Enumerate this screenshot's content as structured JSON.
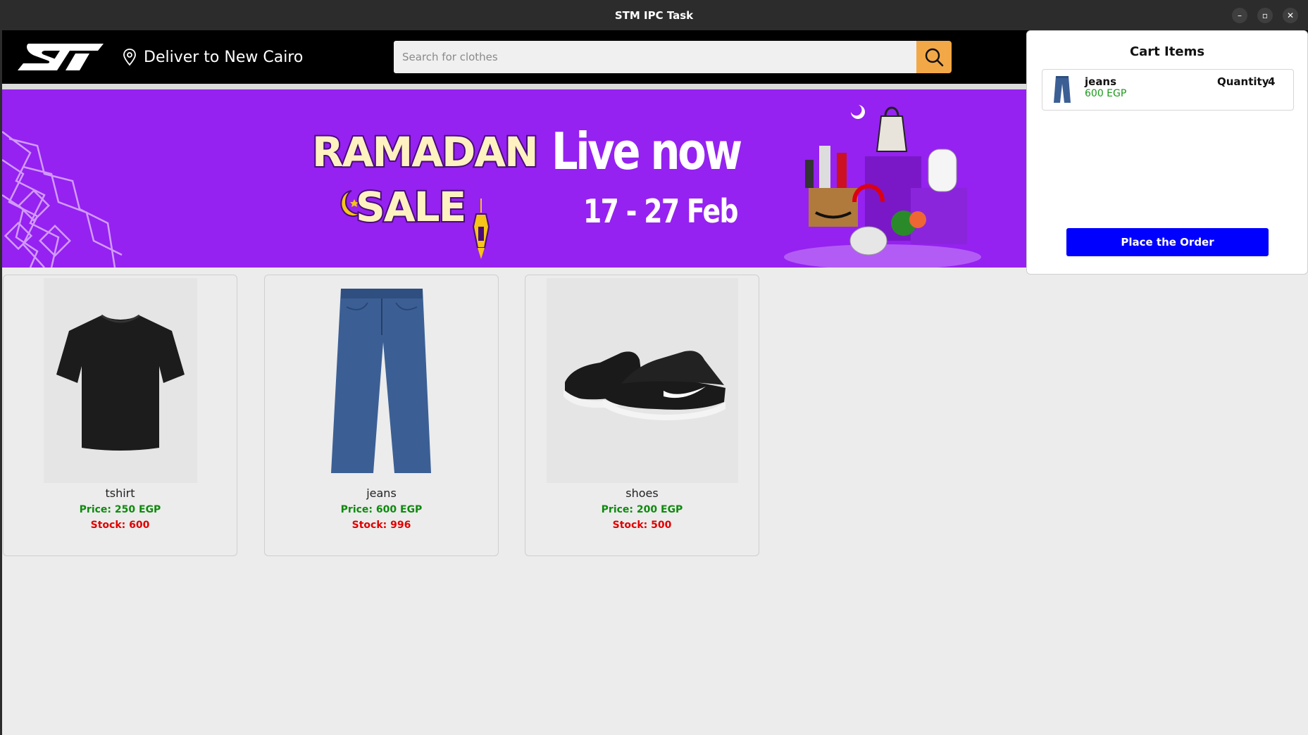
{
  "window": {
    "title": "STM IPC Task",
    "min_glyph": "–",
    "max_glyph": "▫",
    "close_glyph": "✕"
  },
  "header": {
    "logo_icon": "st-logo",
    "deliver_text": "Deliver to New Cairo",
    "search_placeholder": "Search for clothes",
    "search_value": "",
    "accent_color": "#f3a847"
  },
  "banner": {
    "line1": "RAMADAN",
    "line2": "SALE",
    "headline": "Live now",
    "dates": "17 - 27 Feb",
    "background": "#9522f0"
  },
  "products": [
    {
      "name": "tshirt",
      "price": "Price: 250 EGP",
      "stock": "Stock: 600",
      "icon": "tshirt-image"
    },
    {
      "name": "jeans",
      "price": "Price: 600 EGP",
      "stock": "Stock: 996",
      "icon": "jeans-image"
    },
    {
      "name": "shoes",
      "price": "Price: 200 EGP",
      "stock": "Stock: 500",
      "icon": "shoes-image"
    }
  ],
  "cart": {
    "title": "Cart Items",
    "items": [
      {
        "name": "jeans",
        "price": "600 EGP",
        "quantity_label": "Quantity",
        "quantity": "4",
        "icon": "jeans-thumbnail"
      }
    ],
    "order_button": "Place the Order",
    "button_color": "#0000ff"
  }
}
